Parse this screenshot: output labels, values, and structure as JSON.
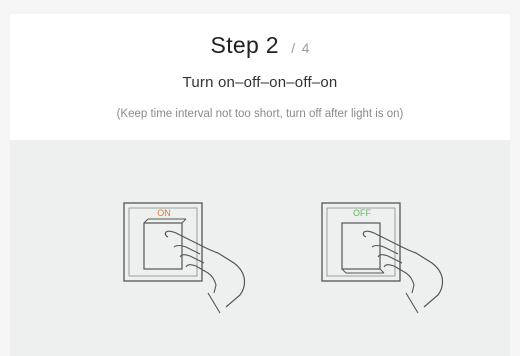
{
  "step": {
    "title": "Step 2",
    "separator": "/",
    "total": "4"
  },
  "instruction": "Turn on–off–on–off–on",
  "note": "(Keep time interval not too short, turn off after light is on)",
  "switches": [
    {
      "label": "ON",
      "color": "#e8742a"
    },
    {
      "label": "OFF",
      "color": "#5cb85c"
    }
  ],
  "colors": {
    "panel_bg": "#eef0ef",
    "header_bg": "#ffffff",
    "line": "#555555"
  },
  "icons": [
    "wall-switch-hand-icon",
    "wall-switch-hand-icon"
  ]
}
